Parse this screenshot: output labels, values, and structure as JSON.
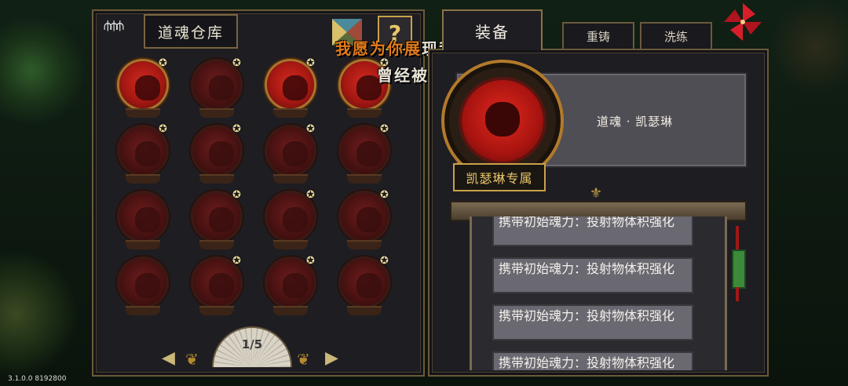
{
  "warehouse": {
    "title": "道魂仓库",
    "help_label": "?"
  },
  "lyrics": {
    "line1_highlight": "我愿为你展",
    "line1_rest": "现我的美",
    "line2": "曾经被风吹"
  },
  "pager": {
    "page_label": "1/5",
    "prev": "◀",
    "next": "▶"
  },
  "tabs": {
    "equip": "装备",
    "recast": "重铸",
    "refine": "洗练"
  },
  "detail": {
    "name": "道魂 · 凯瑟琳",
    "exclusive_label": "凯瑟琳专属"
  },
  "effects": [
    "携带初始魂力：投射物体积强化",
    "携带初始魂力：投射物体积强化",
    "携带初始魂力：投射物体积强化",
    "携带初始魂力：投射物体积强化"
  ],
  "version": "3.1.0.0 8192800",
  "colors": {
    "accent_gold": "#c9a24a",
    "active_red": "#d22a20",
    "lyric_highlight": "#e37a1a"
  }
}
